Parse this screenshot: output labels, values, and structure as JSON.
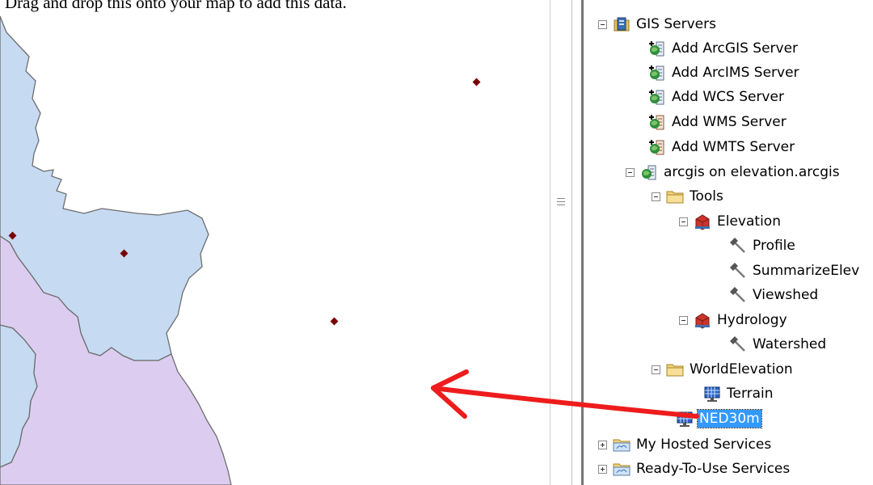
{
  "caption": "Drag and drop this onto your map to add this data.",
  "tree": {
    "gis_servers": "GIS Servers",
    "add_arcgis": "Add ArcGIS Server",
    "add_arcims": "Add ArcIMS Server",
    "add_wcs": "Add WCS Server",
    "add_wms": "Add WMS Server",
    "add_wmts": "Add WMTS Server",
    "arcgis_conn": "arcgis on elevation.arcgis",
    "tools": "Tools",
    "elevation": "Elevation",
    "profile": "Profile",
    "summarize": "SummarizeElev",
    "viewshed": "Viewshed",
    "hydrology": "Hydrology",
    "watershed": "Watershed",
    "world_elevation": "WorldElevation",
    "terrain": "Terrain",
    "ned30m": "NED30m",
    "my_hosted": "My Hosted Services",
    "ready_to_use": "Ready-To-Use Services"
  },
  "colors": {
    "watershed_blue": "#c6daf2",
    "watershed_purple": "#dccdf0",
    "boundary": "#6e6e6e",
    "point": "#7a0000",
    "arrow": "#ee1c1c",
    "selection": "#3399ff"
  }
}
